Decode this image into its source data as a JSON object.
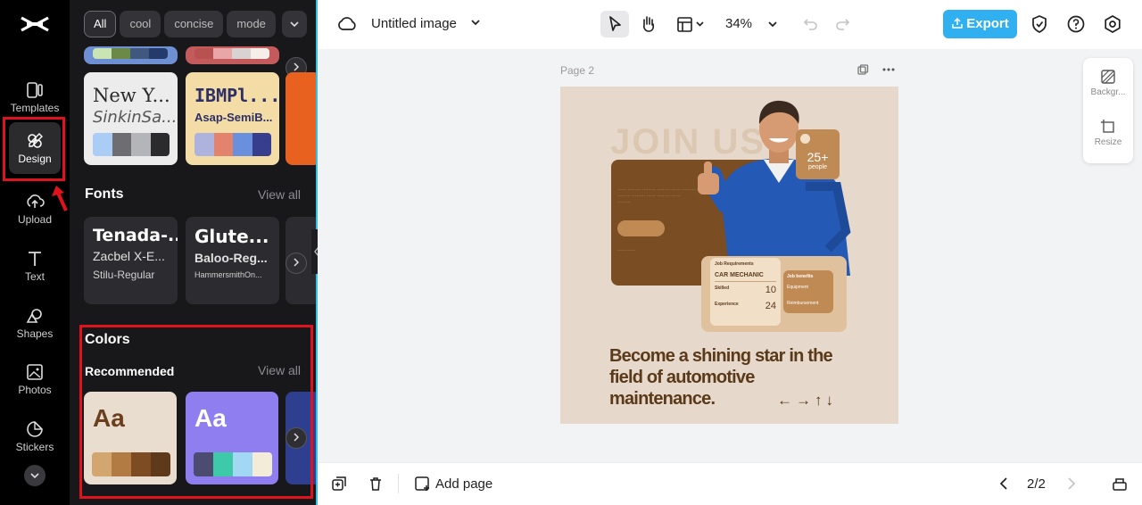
{
  "rail": {
    "items": [
      {
        "label": "Templates"
      },
      {
        "label": "Design"
      },
      {
        "label": "Upload"
      },
      {
        "label": "Text"
      },
      {
        "label": "Shapes"
      },
      {
        "label": "Photos"
      },
      {
        "label": "Stickers"
      }
    ]
  },
  "panel": {
    "chips": [
      "All",
      "cool",
      "concise",
      "mode"
    ],
    "themes": [
      {
        "line1": "New Y...",
        "line2": "SinkinSa...",
        "swatches": [
          "#a9cdf5",
          "#6e6e72",
          "#b3b5b8",
          "#2b2b2e"
        ],
        "bg": "#ececec"
      },
      {
        "line1": "IBMPl...",
        "line2": "Asap-SemiB...",
        "swatches": [
          "#aeb3de",
          "#e2836e",
          "#6a8fdc",
          "#373e8c"
        ],
        "bg": "#f3dca5"
      }
    ],
    "fonts": {
      "title": "Fonts",
      "view_all": "View all",
      "items": [
        {
          "line1": "Tenada-...",
          "line2": "Zacbel X-E...",
          "line3": "Stilu-Regular"
        },
        {
          "line1": "Glute...",
          "line2": "Baloo-Reg...",
          "line3": "HammersmithOn..."
        }
      ]
    },
    "colors": {
      "title": "Colors",
      "subtitle": "Recommended",
      "view_all": "View all",
      "palettes": [
        {
          "aa": "Aa",
          "bg": "#e9ddd0",
          "text_color": "#6b3f1d",
          "swatches": [
            "#d3a66f",
            "#b27b44",
            "#7e4c22",
            "#5e3a1b"
          ]
        },
        {
          "aa": "Aa",
          "bg": "#8e7ef0",
          "text_color": "#ffffff",
          "swatches": [
            "#4c4b70",
            "#3ec9a8",
            "#a3d8f5",
            "#f3ecd8"
          ]
        }
      ]
    }
  },
  "topbar": {
    "title": "Untitled image",
    "zoom": "34%",
    "export_label": "Export"
  },
  "canvas": {
    "page_label": "Page 2",
    "design": {
      "join": "JOIN US",
      "count": "25+",
      "count_label": "people",
      "job_heading": "Job Requirements",
      "job_title": "CAR MECHANIC",
      "job_skilled": "Skilled",
      "job_skilled_value": "10",
      "job_experience": "Experience",
      "job_experience_value": "24",
      "benefit_heading": "Job benefits",
      "benefit_1": "Equipment",
      "benefit_2": "Reimbursement",
      "tagline": "Become a shining star in the field of automotive maintenance.",
      "arrows": "←→↑↓"
    },
    "side_tools": [
      {
        "label": "Backgr..."
      },
      {
        "label": "Resize"
      }
    ]
  },
  "bottombar": {
    "add_page": "Add page",
    "pager": "2/2"
  }
}
